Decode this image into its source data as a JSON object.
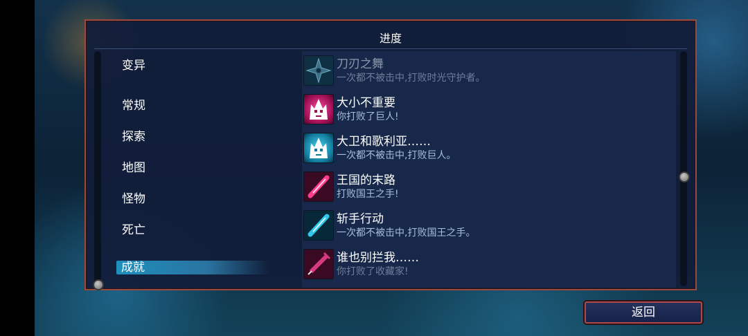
{
  "panel": {
    "title": "进度"
  },
  "categories": [
    {
      "label": "变异",
      "selected": false
    },
    {
      "label": "常规",
      "selected": false
    },
    {
      "label": "探索",
      "selected": false
    },
    {
      "label": "地图",
      "selected": false
    },
    {
      "label": "怪物",
      "selected": false
    },
    {
      "label": "死亡",
      "selected": false
    },
    {
      "label": "成就",
      "selected": true
    }
  ],
  "achievements": [
    {
      "title": "刀刃之舞",
      "desc": "一次都不被击中,打败时光守护者。",
      "icon": "shuriken-icon",
      "unlocked": false
    },
    {
      "title": "大小不重要",
      "desc": "你打败了巨人!",
      "icon": "giant-skull-icon",
      "unlocked": true
    },
    {
      "title": "大卫和歌利亚……",
      "desc": "一次都不被击中,打败巨人。",
      "icon": "giant-skull-icon",
      "unlocked": true
    },
    {
      "title": "王国的末路",
      "desc": "打败国王之手!",
      "icon": "blade-icon",
      "unlocked": true
    },
    {
      "title": "斩手行动",
      "desc": "一次都不被击中,打败国王之手。",
      "icon": "blade-icon",
      "unlocked": true
    },
    {
      "title": "谁也别拦我……",
      "desc": "你打败了收藏家!",
      "icon": "syringe-icon",
      "unlocked": true
    }
  ],
  "scroll": {
    "list_position": 0.55,
    "categories_position": 1.0
  },
  "buttons": {
    "back": "返回"
  },
  "colors": {
    "panel_border": "#9b4a3e",
    "selected_category": "#1f8fbc",
    "icon_magenta": "#e0287a",
    "icon_cyan": "#22b5d8"
  }
}
